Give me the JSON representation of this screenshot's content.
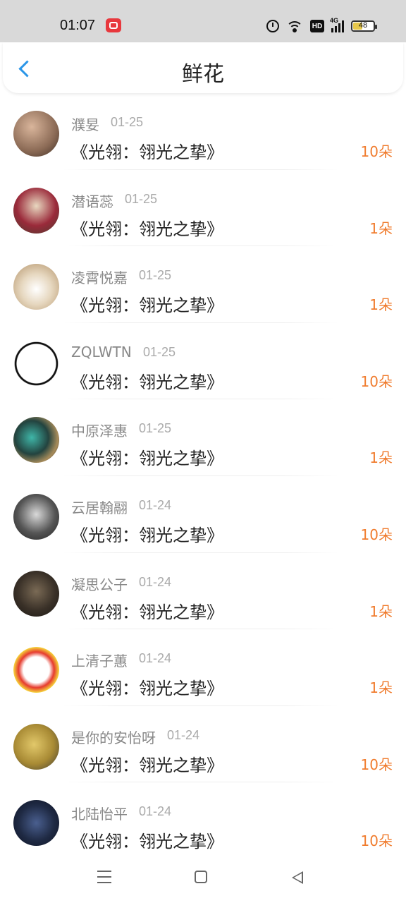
{
  "status": {
    "time": "01:07",
    "hd": "HD",
    "network": "4G",
    "battery": "48",
    "battery_level": 0.48
  },
  "header": {
    "title": "鲜花",
    "back_icon": "chevron-left-icon"
  },
  "list": [
    {
      "name": "濮妟",
      "date": "01-25",
      "book": "《光翎：翎光之挚》",
      "count": "10朵"
    },
    {
      "name": "潜语蕊",
      "date": "01-25",
      "book": "《光翎：翎光之挚》",
      "count": "1朵"
    },
    {
      "name": "凌霄悦嘉",
      "date": "01-25",
      "book": "《光翎：翎光之挚》",
      "count": "1朵"
    },
    {
      "name": "ZQLWTN",
      "date": "01-25",
      "book": "《光翎：翎光之挚》",
      "count": "10朵"
    },
    {
      "name": "中原泽惠",
      "date": "01-25",
      "book": "《光翎：翎光之挚》",
      "count": "1朵"
    },
    {
      "name": "云居翰翮",
      "date": "01-24",
      "book": "《光翎：翎光之挚》",
      "count": "10朵"
    },
    {
      "name": "凝思公子",
      "date": "01-24",
      "book": "《光翎：翎光之挚》",
      "count": "1朵"
    },
    {
      "name": "上清子蕙",
      "date": "01-24",
      "book": "《光翎：翎光之挚》",
      "count": "1朵"
    },
    {
      "name": "是你的安怡呀",
      "date": "01-24",
      "book": "《光翎：翎光之挚》",
      "count": "10朵"
    },
    {
      "name": "北陆怡平",
      "date": "01-24",
      "book": "《光翎：翎光之挚》",
      "count": "10朵"
    }
  ],
  "colors": {
    "accent": "#2b96e8",
    "count": "#f07c2e",
    "username": "#888888"
  },
  "nav": {
    "menu_icon": "menu-icon",
    "home_icon": "home-icon",
    "back_icon": "back-triangle-icon"
  }
}
